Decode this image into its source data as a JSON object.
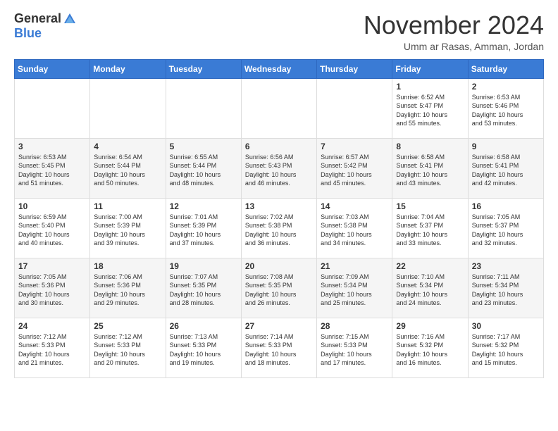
{
  "header": {
    "logo_general": "General",
    "logo_blue": "Blue",
    "month_title": "November 2024",
    "location": "Umm ar Rasas, Amman, Jordan"
  },
  "weekdays": [
    "Sunday",
    "Monday",
    "Tuesday",
    "Wednesday",
    "Thursday",
    "Friday",
    "Saturday"
  ],
  "weeks": [
    [
      {
        "day": "",
        "info": ""
      },
      {
        "day": "",
        "info": ""
      },
      {
        "day": "",
        "info": ""
      },
      {
        "day": "",
        "info": ""
      },
      {
        "day": "",
        "info": ""
      },
      {
        "day": "1",
        "info": "Sunrise: 6:52 AM\nSunset: 5:47 PM\nDaylight: 10 hours\nand 55 minutes."
      },
      {
        "day": "2",
        "info": "Sunrise: 6:53 AM\nSunset: 5:46 PM\nDaylight: 10 hours\nand 53 minutes."
      }
    ],
    [
      {
        "day": "3",
        "info": "Sunrise: 6:53 AM\nSunset: 5:45 PM\nDaylight: 10 hours\nand 51 minutes."
      },
      {
        "day": "4",
        "info": "Sunrise: 6:54 AM\nSunset: 5:44 PM\nDaylight: 10 hours\nand 50 minutes."
      },
      {
        "day": "5",
        "info": "Sunrise: 6:55 AM\nSunset: 5:44 PM\nDaylight: 10 hours\nand 48 minutes."
      },
      {
        "day": "6",
        "info": "Sunrise: 6:56 AM\nSunset: 5:43 PM\nDaylight: 10 hours\nand 46 minutes."
      },
      {
        "day": "7",
        "info": "Sunrise: 6:57 AM\nSunset: 5:42 PM\nDaylight: 10 hours\nand 45 minutes."
      },
      {
        "day": "8",
        "info": "Sunrise: 6:58 AM\nSunset: 5:41 PM\nDaylight: 10 hours\nand 43 minutes."
      },
      {
        "day": "9",
        "info": "Sunrise: 6:58 AM\nSunset: 5:41 PM\nDaylight: 10 hours\nand 42 minutes."
      }
    ],
    [
      {
        "day": "10",
        "info": "Sunrise: 6:59 AM\nSunset: 5:40 PM\nDaylight: 10 hours\nand 40 minutes."
      },
      {
        "day": "11",
        "info": "Sunrise: 7:00 AM\nSunset: 5:39 PM\nDaylight: 10 hours\nand 39 minutes."
      },
      {
        "day": "12",
        "info": "Sunrise: 7:01 AM\nSunset: 5:39 PM\nDaylight: 10 hours\nand 37 minutes."
      },
      {
        "day": "13",
        "info": "Sunrise: 7:02 AM\nSunset: 5:38 PM\nDaylight: 10 hours\nand 36 minutes."
      },
      {
        "day": "14",
        "info": "Sunrise: 7:03 AM\nSunset: 5:38 PM\nDaylight: 10 hours\nand 34 minutes."
      },
      {
        "day": "15",
        "info": "Sunrise: 7:04 AM\nSunset: 5:37 PM\nDaylight: 10 hours\nand 33 minutes."
      },
      {
        "day": "16",
        "info": "Sunrise: 7:05 AM\nSunset: 5:37 PM\nDaylight: 10 hours\nand 32 minutes."
      }
    ],
    [
      {
        "day": "17",
        "info": "Sunrise: 7:05 AM\nSunset: 5:36 PM\nDaylight: 10 hours\nand 30 minutes."
      },
      {
        "day": "18",
        "info": "Sunrise: 7:06 AM\nSunset: 5:36 PM\nDaylight: 10 hours\nand 29 minutes."
      },
      {
        "day": "19",
        "info": "Sunrise: 7:07 AM\nSunset: 5:35 PM\nDaylight: 10 hours\nand 28 minutes."
      },
      {
        "day": "20",
        "info": "Sunrise: 7:08 AM\nSunset: 5:35 PM\nDaylight: 10 hours\nand 26 minutes."
      },
      {
        "day": "21",
        "info": "Sunrise: 7:09 AM\nSunset: 5:34 PM\nDaylight: 10 hours\nand 25 minutes."
      },
      {
        "day": "22",
        "info": "Sunrise: 7:10 AM\nSunset: 5:34 PM\nDaylight: 10 hours\nand 24 minutes."
      },
      {
        "day": "23",
        "info": "Sunrise: 7:11 AM\nSunset: 5:34 PM\nDaylight: 10 hours\nand 23 minutes."
      }
    ],
    [
      {
        "day": "24",
        "info": "Sunrise: 7:12 AM\nSunset: 5:33 PM\nDaylight: 10 hours\nand 21 minutes."
      },
      {
        "day": "25",
        "info": "Sunrise: 7:12 AM\nSunset: 5:33 PM\nDaylight: 10 hours\nand 20 minutes."
      },
      {
        "day": "26",
        "info": "Sunrise: 7:13 AM\nSunset: 5:33 PM\nDaylight: 10 hours\nand 19 minutes."
      },
      {
        "day": "27",
        "info": "Sunrise: 7:14 AM\nSunset: 5:33 PM\nDaylight: 10 hours\nand 18 minutes."
      },
      {
        "day": "28",
        "info": "Sunrise: 7:15 AM\nSunset: 5:33 PM\nDaylight: 10 hours\nand 17 minutes."
      },
      {
        "day": "29",
        "info": "Sunrise: 7:16 AM\nSunset: 5:32 PM\nDaylight: 10 hours\nand 16 minutes."
      },
      {
        "day": "30",
        "info": "Sunrise: 7:17 AM\nSunset: 5:32 PM\nDaylight: 10 hours\nand 15 minutes."
      }
    ]
  ]
}
